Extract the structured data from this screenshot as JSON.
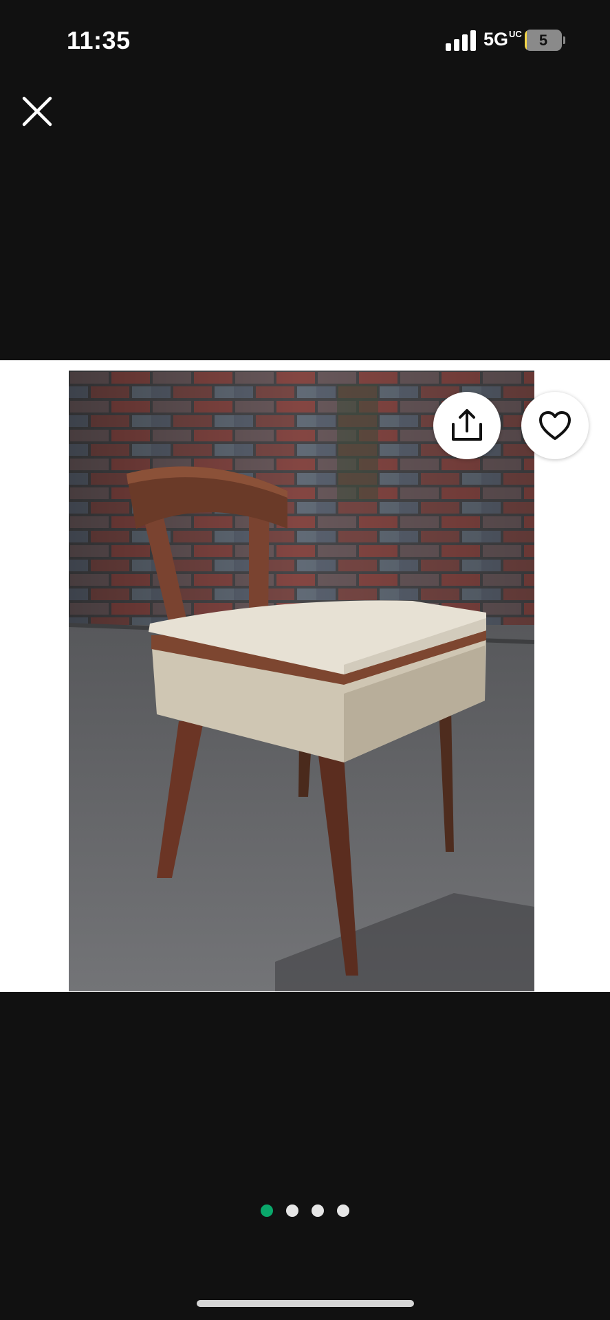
{
  "status_bar": {
    "time": "11:35",
    "network": "5G",
    "network_suffix": "UC",
    "battery_level": "5",
    "battery_fraction": 0.05,
    "icons": [
      "signal-bars-icon",
      "battery-icon"
    ]
  },
  "viewer": {
    "close_icon": "close-icon",
    "share_icon": "share-icon",
    "favorite_icon": "heart-icon",
    "photo_subject": "wooden-chair-photo",
    "page_count": 4,
    "active_page": 1
  },
  "colors": {
    "background": "#111111",
    "panel": "#ffffff",
    "active_dot": "#0aa86b",
    "inactive_dot": "#e6e6e6"
  }
}
